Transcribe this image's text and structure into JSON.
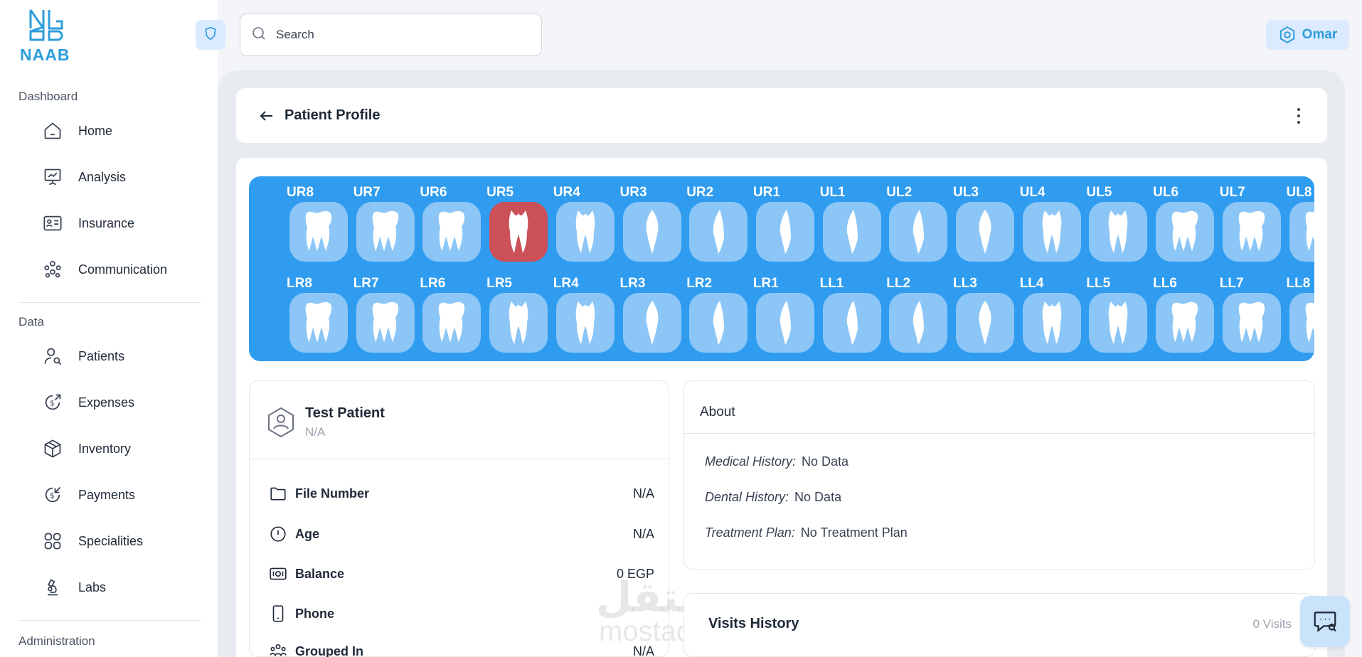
{
  "brand": {
    "name": "NAAB",
    "color": "#2d9cdb"
  },
  "search": {
    "placeholder": "Search"
  },
  "user": {
    "name": "Omar"
  },
  "sidebar": {
    "sections": [
      {
        "title": "Dashboard"
      },
      {
        "title": "Data"
      },
      {
        "title": "Administration"
      }
    ],
    "items": [
      {
        "label": "Home",
        "icon": "home-icon"
      },
      {
        "label": "Analysis",
        "icon": "presentation-chart-icon"
      },
      {
        "label": "Insurance",
        "icon": "id-card-icon"
      },
      {
        "label": "Communication",
        "icon": "people-group-icon"
      },
      {
        "label": "Patients",
        "icon": "user-search-icon"
      },
      {
        "label": "Expenses",
        "icon": "money-out-icon"
      },
      {
        "label": "Inventory",
        "icon": "box-icon"
      },
      {
        "label": "Payments",
        "icon": "money-in-icon"
      },
      {
        "label": "Specialities",
        "icon": "grid-icon"
      },
      {
        "label": "Labs",
        "icon": "microscope-icon"
      }
    ]
  },
  "header": {
    "title": "Patient Profile"
  },
  "teeth": {
    "upper": [
      "UR8",
      "UR7",
      "UR6",
      "UR5",
      "UR4",
      "UR3",
      "UR2",
      "UR1",
      "UL1",
      "UL2",
      "UL3",
      "UL4",
      "UL5",
      "UL6",
      "UL7",
      "UL8"
    ],
    "lower": [
      "LR8",
      "LR7",
      "LR6",
      "LR5",
      "LR4",
      "LR3",
      "LR2",
      "LR1",
      "LL1",
      "LL2",
      "LL3",
      "LL4",
      "LL5",
      "LL6",
      "LL7",
      "LL8"
    ],
    "selected": "UR5",
    "chart_color": "#2f9cf0",
    "selected_color": "#cc5058"
  },
  "patient": {
    "name": "Test Patient",
    "subtitle": "N/A",
    "fields": [
      {
        "label": "File Number",
        "value": "N/A",
        "icon": "folder-icon"
      },
      {
        "label": "Age",
        "value": "N/A",
        "icon": "alert-circle-icon"
      },
      {
        "label": "Balance",
        "value": "0 EGP",
        "icon": "cash-icon"
      },
      {
        "label": "Phone",
        "value": "",
        "icon": "phone-icon"
      },
      {
        "label": "Grouped In",
        "value": "N/A",
        "icon": "group-icon"
      }
    ]
  },
  "about": {
    "title": "About",
    "rows": [
      {
        "label": "Medical History:",
        "value": "No Data"
      },
      {
        "label": "Dental History:",
        "value": "No Data"
      },
      {
        "label": "Treatment Plan:",
        "value": "No Treatment Plan"
      }
    ]
  },
  "visits": {
    "title": "Visits History",
    "count": "0 Visits"
  },
  "watermark": {
    "arabic": "مستقل",
    "latin": "mostaql.com"
  }
}
